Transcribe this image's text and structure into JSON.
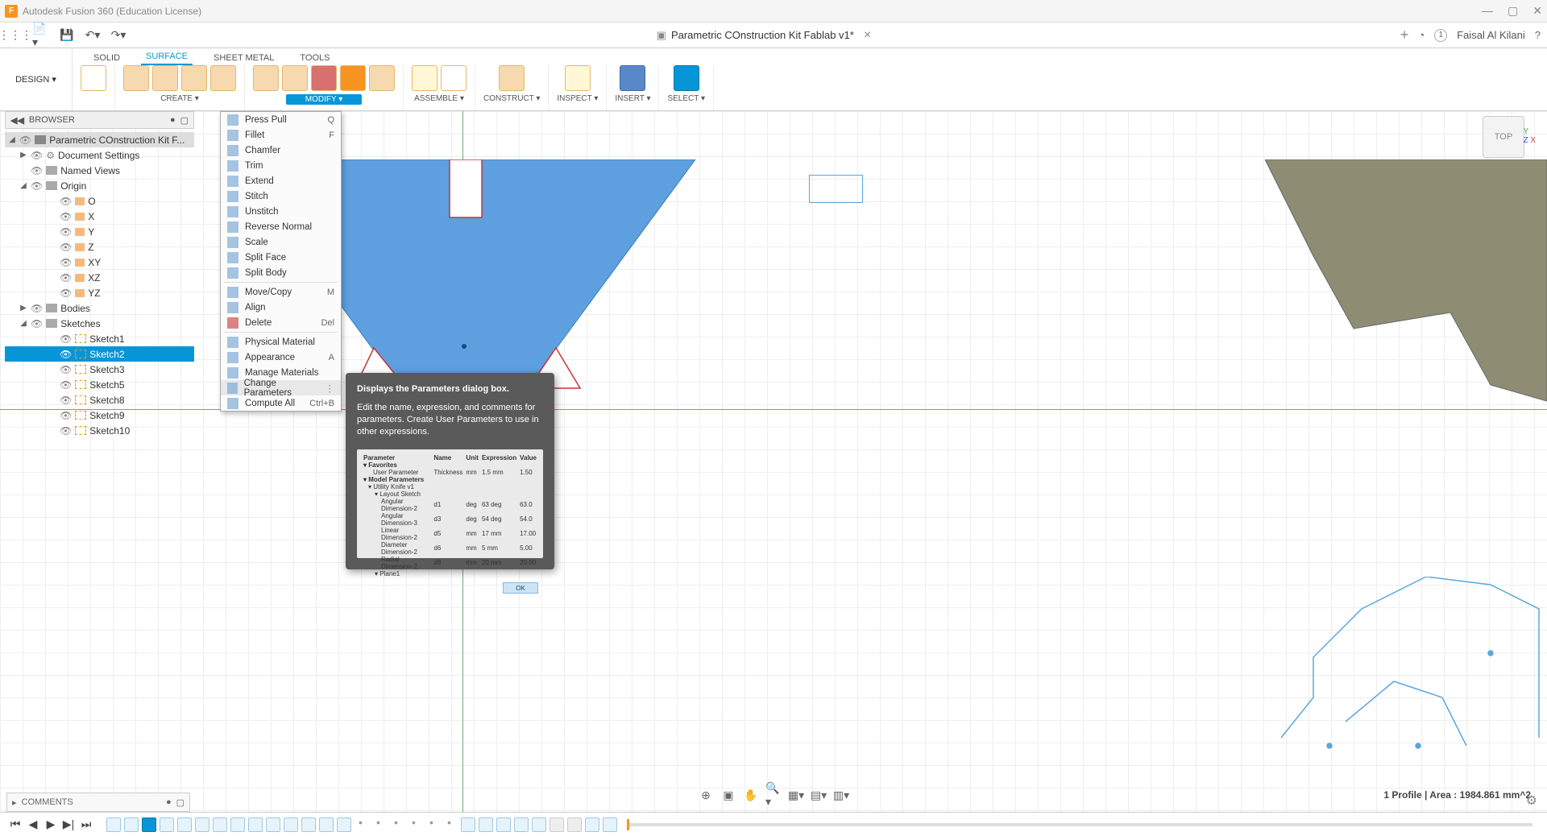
{
  "app": {
    "title": "Autodesk Fusion 360 (Education License)",
    "document_title": "Parametric COnstruction Kit Fablab v1*",
    "username": "Faisal Al Kilani"
  },
  "design_button": "DESIGN ▾",
  "workspace_tabs": [
    "SOLID",
    "SURFACE",
    "SHEET METAL",
    "TOOLS"
  ],
  "workspace_active": "SURFACE",
  "ribbon_groups": [
    {
      "label": "CREATE ▾"
    },
    {
      "label": "MODIFY ▾",
      "active": true
    },
    {
      "label": "ASSEMBLE ▾"
    },
    {
      "label": "CONSTRUCT ▾"
    },
    {
      "label": "INSPECT ▾"
    },
    {
      "label": "INSERT ▾"
    },
    {
      "label": "SELECT ▾"
    }
  ],
  "browser": {
    "title": "BROWSER",
    "root": "Parametric COnstruction Kit F...",
    "items": [
      {
        "label": "Document Settings",
        "indent": 1,
        "arrow": "▶",
        "icon": "gear"
      },
      {
        "label": "Named Views",
        "indent": 1,
        "icon": "folder"
      },
      {
        "label": "Origin",
        "indent": 1,
        "arrow": "◢",
        "icon": "folder"
      },
      {
        "label": "O",
        "indent": 3,
        "origin": true
      },
      {
        "label": "X",
        "indent": 3,
        "origin": true
      },
      {
        "label": "Y",
        "indent": 3,
        "origin": true
      },
      {
        "label": "Z",
        "indent": 3,
        "origin": true
      },
      {
        "label": "XY",
        "indent": 3,
        "origin": true
      },
      {
        "label": "XZ",
        "indent": 3,
        "origin": true
      },
      {
        "label": "YZ",
        "indent": 3,
        "origin": true
      },
      {
        "label": "Bodies",
        "indent": 1,
        "arrow": "▶",
        "icon": "folder"
      },
      {
        "label": "Sketches",
        "indent": 1,
        "arrow": "◢",
        "icon": "folder"
      },
      {
        "label": "Sketch1",
        "indent": 3,
        "sketch": true
      },
      {
        "label": "Sketch2",
        "indent": 3,
        "sketch": true,
        "active": true
      },
      {
        "label": "Sketch3",
        "indent": 3,
        "sketch": true
      },
      {
        "label": "Sketch5",
        "indent": 3,
        "sketch": true
      },
      {
        "label": "Sketch8",
        "indent": 3,
        "sketch": true
      },
      {
        "label": "Sketch9",
        "indent": 3,
        "sketch": true
      },
      {
        "label": "Sketch10",
        "indent": 3,
        "sketch": true
      }
    ]
  },
  "modify_menu": [
    {
      "label": "Press Pull",
      "shortcut": "Q"
    },
    {
      "label": "Fillet",
      "shortcut": "F"
    },
    {
      "label": "Chamfer"
    },
    {
      "label": "Trim"
    },
    {
      "label": "Extend"
    },
    {
      "label": "Stitch"
    },
    {
      "label": "Unstitch"
    },
    {
      "label": "Reverse Normal"
    },
    {
      "label": "Scale"
    },
    {
      "label": "Split Face"
    },
    {
      "label": "Split Body"
    },
    {
      "sep": true
    },
    {
      "label": "Move/Copy",
      "shortcut": "M"
    },
    {
      "label": "Align"
    },
    {
      "label": "Delete",
      "shortcut": "Del",
      "redicon": true
    },
    {
      "sep": true
    },
    {
      "label": "Physical Material"
    },
    {
      "label": "Appearance",
      "shortcut": "A"
    },
    {
      "label": "Manage Materials"
    },
    {
      "label": "Change Parameters",
      "hover": true,
      "dots": true
    },
    {
      "label": "Compute All",
      "shortcut": "Ctrl+B"
    }
  ],
  "tooltip": {
    "title": "Displays the Parameters dialog box.",
    "body": "Edit the name, expression, and comments for parameters. Create User Parameters to use in other expressions.",
    "ok": "OK",
    "table": {
      "headers": [
        "Parameter",
        "Name",
        "Unit",
        "Expression",
        "Value"
      ],
      "groups": [
        "Favorites",
        "User Parameter",
        "Model Parameters",
        "Utility Knife v1",
        "Layout Sketch",
        "Plane1"
      ],
      "rows": [
        [
          "Thickness",
          "mm",
          "1.5 mm",
          "1.50"
        ],
        [
          "Angular Dimension-2",
          "d1",
          "deg",
          "63 deg",
          "63.0"
        ],
        [
          "Angular Dimension-3",
          "d3",
          "deg",
          "54 deg",
          "54.0"
        ],
        [
          "Linear Dimension-2",
          "d5",
          "mm",
          "17 mm",
          "17.00"
        ],
        [
          "Diameter Dimension-2",
          "d6",
          "mm",
          "5 mm",
          "5.00"
        ],
        [
          "Radial Dimension-2",
          "d8",
          "mm",
          "20 mm",
          "20.00"
        ]
      ]
    }
  },
  "viewcube": "TOP",
  "axes": {
    "y": "Y",
    "x": "X",
    "z": "Z"
  },
  "status": "1 Profile | Area : 1984.861 mm^2",
  "comments": "COMMENTS"
}
